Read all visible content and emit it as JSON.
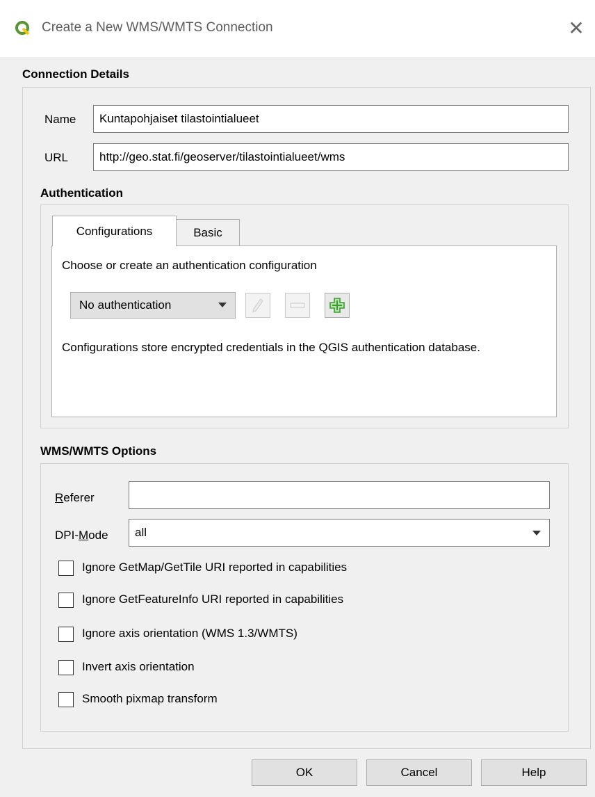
{
  "window": {
    "title": "Create a New WMS/WMTS Connection",
    "close_glyph": "✕",
    "app_icon": "qgis-icon"
  },
  "connection": {
    "heading": "Connection Details",
    "name_label": "Name",
    "name_value": "Kuntapohjaiset tilastointialueet",
    "url_label": "URL",
    "url_value": "http://geo.stat.fi/geoserver/tilastointialueet/wms"
  },
  "authentication": {
    "heading": "Authentication",
    "tabs": [
      {
        "label": "Configurations",
        "active": true
      },
      {
        "label": "Basic",
        "active": false
      }
    ],
    "choose_text": "Choose or create an authentication configuration",
    "selected": "No authentication",
    "tool_icons": [
      "edit-icon",
      "remove-icon",
      "add-icon"
    ],
    "info_text": "Configurations store encrypted credentials in the QGIS authentication database."
  },
  "options": {
    "heading": "WMS/WMTS Options",
    "referer_label_first": "R",
    "referer_label_rest": "eferer",
    "referer_value": "",
    "dpi_label_prefix": "DPI-",
    "dpi_label_underlined": "M",
    "dpi_label_suffix": "ode",
    "dpi_value": "all",
    "checkboxes": [
      {
        "label": "Ignore GetMap/GetTile URI reported in capabilities",
        "checked": false
      },
      {
        "label": "Ignore GetFeatureInfo URI reported in capabilities",
        "checked": false
      },
      {
        "label": "Ignore axis orientation (WMS 1.3/WMTS)",
        "checked": false
      },
      {
        "label": "Invert axis orientation",
        "checked": false
      },
      {
        "label": "Smooth pixmap transform",
        "checked": false
      }
    ]
  },
  "buttons": {
    "ok": "OK",
    "cancel": "Cancel",
    "help": "Help"
  },
  "colors": {
    "qgis_green": "#589632",
    "qgis_yellow": "#f0c419",
    "add_green": "#3c9a32"
  }
}
